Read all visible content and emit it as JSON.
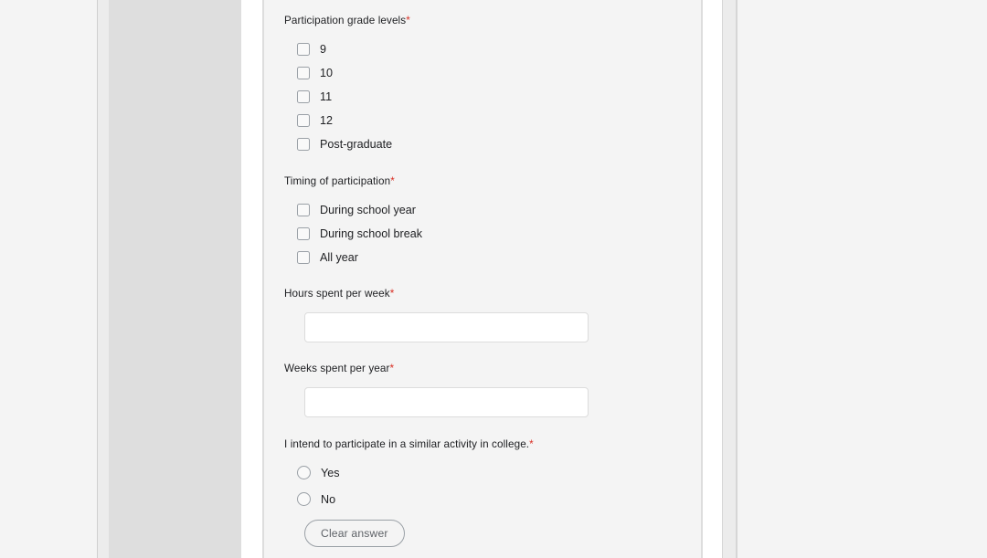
{
  "form": {
    "required_marker": "*",
    "questions": [
      {
        "id": "participation-grade-levels",
        "label": "Participation grade levels",
        "required": true,
        "type": "checkbox",
        "options": [
          {
            "label": "9",
            "checked": false
          },
          {
            "label": "10",
            "checked": false
          },
          {
            "label": "11",
            "checked": false
          },
          {
            "label": "12",
            "checked": false
          },
          {
            "label": "Post-graduate",
            "checked": false
          }
        ]
      },
      {
        "id": "timing-of-participation",
        "label": "Timing of participation",
        "required": true,
        "type": "checkbox",
        "options": [
          {
            "label": "During school year",
            "checked": false
          },
          {
            "label": "During school break",
            "checked": false
          },
          {
            "label": "All year",
            "checked": false
          }
        ]
      },
      {
        "id": "hours-spent-per-week",
        "label": "Hours spent per week",
        "required": true,
        "type": "text",
        "value": "",
        "placeholder": ""
      },
      {
        "id": "weeks-spent-per-year",
        "label": "Weeks spent per year",
        "required": true,
        "type": "text",
        "value": "",
        "placeholder": ""
      },
      {
        "id": "intend-similar-activity-college",
        "label": "I intend to participate in a similar activity in college.",
        "required": true,
        "type": "radio",
        "options": [
          {
            "label": "Yes",
            "selected": false
          },
          {
            "label": "No",
            "selected": false
          }
        ],
        "clear_answer_label": "Clear answer"
      }
    ]
  },
  "colors": {
    "page_background": "#f4f4f4",
    "side_panel": "#dedede",
    "side_rail": "#ececec",
    "required_asterisk": "#d93025",
    "label_text": "#202124",
    "control_border": "#9aa0a6",
    "input_border": "#dcdcdc",
    "input_background": "#ffffff",
    "button_text": "#5f6368"
  }
}
